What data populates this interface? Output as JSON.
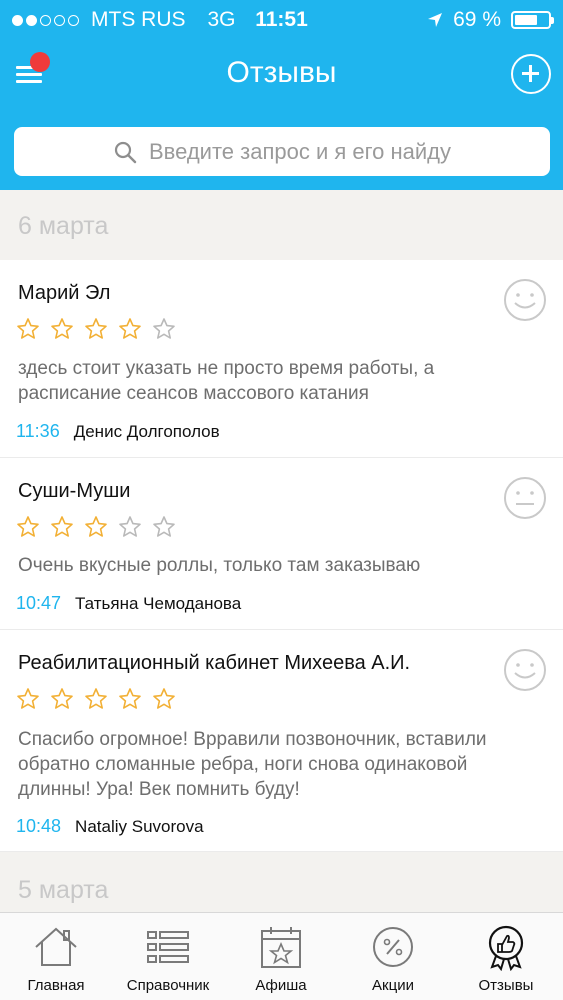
{
  "status_bar": {
    "carrier": "MTS RUS",
    "network": "3G",
    "time": "11:51",
    "battery": "69 %",
    "battery_level": 0.69,
    "signal_bars_filled": 2,
    "signal_bars_total": 5
  },
  "nav": {
    "title": "Отзывы"
  },
  "search": {
    "placeholder": "Введите запрос и я его найду"
  },
  "sections": [
    {
      "date": "6 марта",
      "reviews": [
        {
          "place": "Марий Эл",
          "rating": 4,
          "text": "здесь стоит указать не просто время работы, а расписание сеансов массового катания",
          "time": "11:36",
          "author": "Денис Долгополов",
          "mood": "smile-face-icon"
        },
        {
          "place": "Суши-Муши",
          "rating": 3,
          "text": "Очень вкусные роллы, только там заказываю",
          "time": "10:47",
          "author": "Татьяна Чемоданова",
          "mood": "neutral-face-icon"
        },
        {
          "place": "Реабилитационный кабинет Михеева А.И.",
          "rating": 5,
          "text": "Спасибо огромное! Врравили позвоночник, вставили обратно сломанные ребра, ноги снова одинаковой длинны! Ура! Век помнить буду!",
          "time": "10:48",
          "author": "Nataliy Suvorova",
          "mood": "smile-face-icon"
        }
      ]
    },
    {
      "date": "5 марта",
      "reviews": []
    }
  ],
  "tabs": [
    {
      "label": "Главная",
      "icon": "house-icon"
    },
    {
      "label": "Справочник",
      "icon": "list-icon"
    },
    {
      "label": "Афиша",
      "icon": "calendar-star-icon"
    },
    {
      "label": "Акции",
      "icon": "percent-badge-icon"
    },
    {
      "label": "Отзывы",
      "icon": "thumbs-up-award-icon"
    }
  ],
  "colors": {
    "accent": "#1fb5ee",
    "star": "#f2b035",
    "star_empty": "#b9b9b9",
    "badge": "#ef3b3b"
  }
}
